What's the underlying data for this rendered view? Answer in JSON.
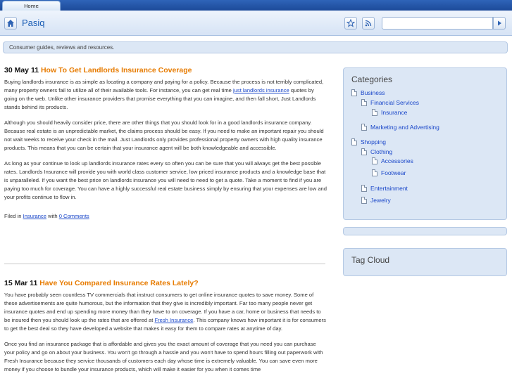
{
  "browser": {
    "tab_label": "Home",
    "site_title": "Pasiq",
    "search": {
      "value": "",
      "placeholder": ""
    },
    "icons": {
      "home": "home-icon",
      "star": "star-icon",
      "rss": "rss-icon",
      "go": "play-icon"
    }
  },
  "tagline": "Consumer guides, reviews and resources.",
  "posts": [
    {
      "date": "30 May 11",
      "title": "How To Get Landlords Insurance Coverage",
      "p1_before": "Buying landlords insurance is as simple as locating a company and paying for a policy. Because the process is not terribly complicated, many property owners fail to utilize all of their available tools. For instance, you can get real time ",
      "p1_link": "just landlords insurance",
      "p1_after": " quotes by going on the web. Unlike other insurance providers that promise everything that you can imagine, and then fall short, Just Landlords stands behind its products.",
      "p2": "Although you should heavily consider price, there are other things that you should look for in a good landlords insurance company. Because real estate is an unpredictable market, the claims process should be easy. If you need to make an important repair you should not wait weeks to receive your check in the mail. Just Landlords only provides professional property owners with high quality insurance products. This means that you can be certain that your insurance agent will be both knowledgeable and accessible.",
      "p3": "As long as your continue to look up landlords insurance rates every so often you can be sure that you will always get the best possible rates. Landlords Insurance will provide you with world class customer service, low priced insurance products and a knowledge base that is unparalleled. If you want the best price on landlords insurance you will need to need to get a quote. Take a moment to find if you are paying too much for coverage. You can have a highly successful real estate business simply by ensuring that your expenses are low and your profits continue to flow in.",
      "filed_prefix": "Filed in ",
      "category": "Insurance",
      "filed_mid": " with ",
      "comments": "0 Comments"
    },
    {
      "date": "15 Mar 11",
      "title": "Have You Compared Insurance Rates Lately?",
      "p1_before": "You have probably seen countless TV commercials that instruct consumers to get online insurance quotes to save money. Some of these advertisements are quite humorous, but the information that they give is incredibly important. Far too many people never get insurance quotes and end up spending more money than they have to on coverage. If you have a car, home or business that needs to be insured then you should look up the rates that are offered at ",
      "p1_link": "Fresh Insurance",
      "p1_after": ". This company knows how important it is for consumers to get the best deal so they have developed a website that makes it easy for them to compare rates at anytime of day.",
      "p2": "Once you find an insurance package that is affordable and gives you the exact amount of coverage that you need you can purchase your policy and go on about your business. You won't go through a hassle and you won't have to spend hours filling out paperwork with Fresh Insurance because they service thousands of customers each day whose time is extremely valuable. You can save even more money if you choose to bundle your insurance products, which will make it easier for you when it comes time"
    }
  ],
  "sidebar": {
    "categories_title": "Categories",
    "categories": [
      {
        "label": "Business"
      },
      {
        "label": "Financial Services"
      },
      {
        "label": "Insurance"
      },
      {
        "label": "Marketing and Advertising"
      },
      {
        "label": "Shopping"
      },
      {
        "label": "Clothing"
      },
      {
        "label": "Accessories"
      },
      {
        "label": "Footwear"
      },
      {
        "label": "Entertainment"
      },
      {
        "label": "Jewelry"
      }
    ],
    "tag_cloud_title": "Tag Cloud"
  }
}
